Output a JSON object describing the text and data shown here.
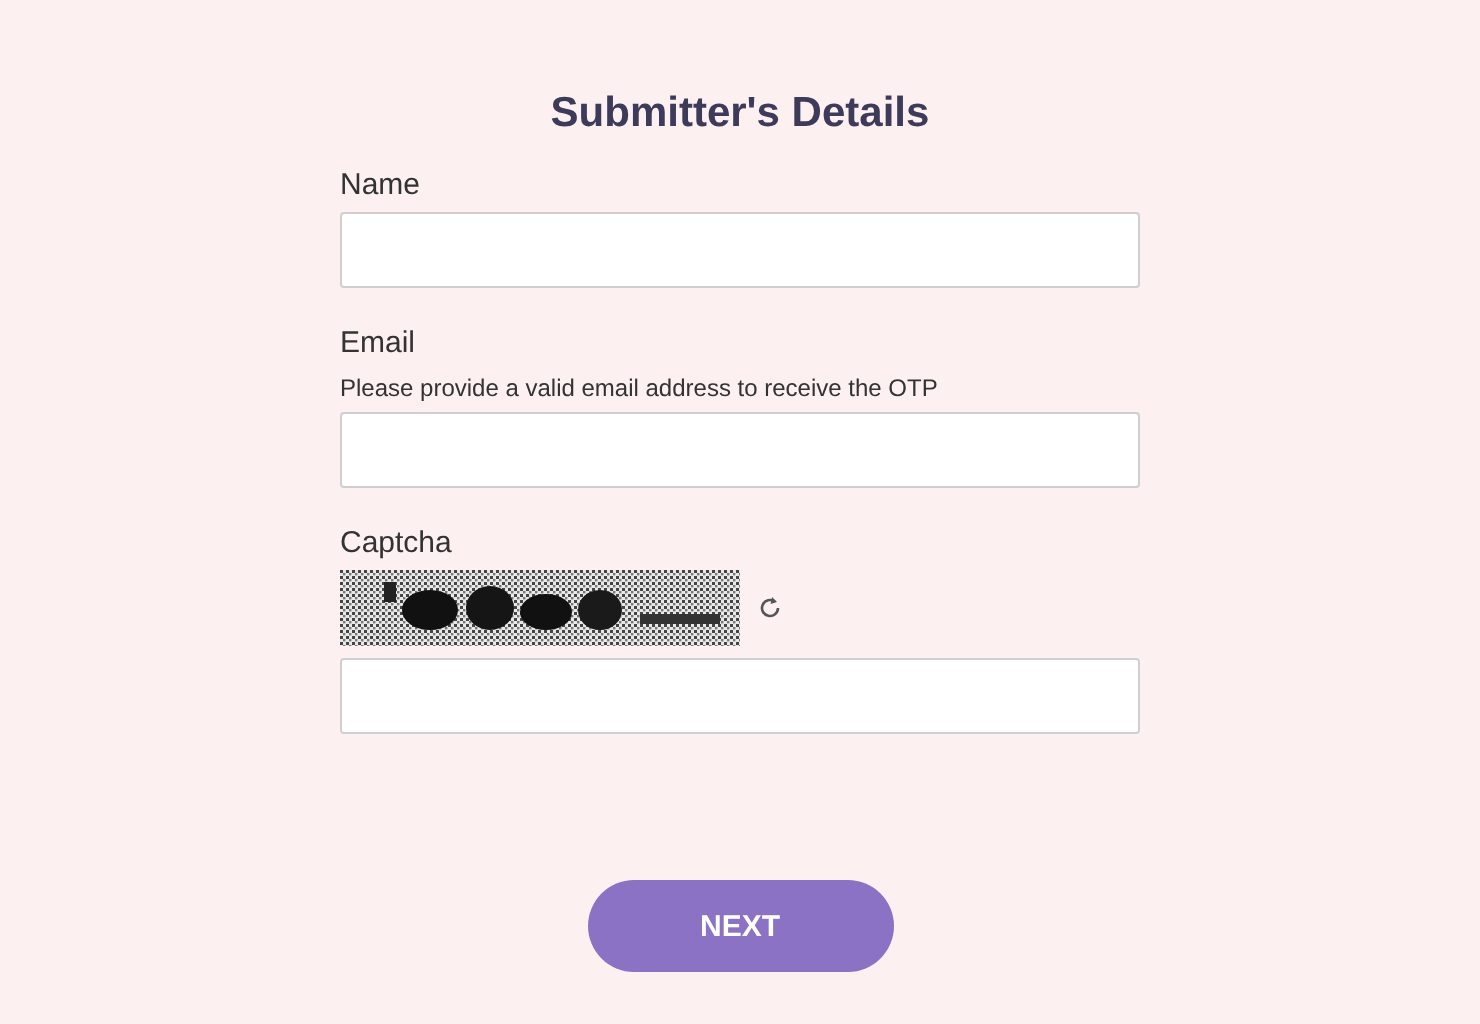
{
  "title": "Submitter's Details",
  "fields": [
    {
      "kind": "text",
      "label": "Name"
    },
    {
      "kind": "text",
      "label": "Email",
      "hint": "Please provide a valid email address to receive the OTP"
    },
    {
      "kind": "captcha",
      "label": "Captcha"
    }
  ],
  "button": {
    "label": "NEXT"
  }
}
